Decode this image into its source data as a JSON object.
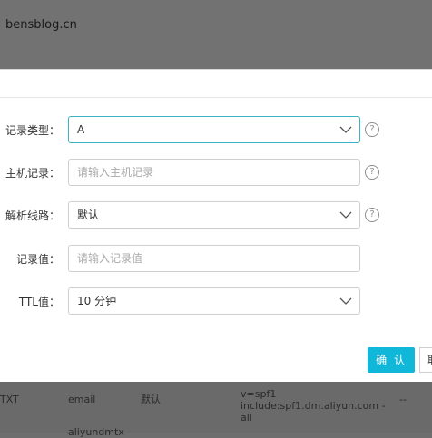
{
  "background": {
    "site_name": "bensblog.cn",
    "table_row": {
      "type": "TXT",
      "host": "email",
      "line": "默认",
      "value": "v=spf1 include:spf1.dm.aliyun.com -all",
      "ttl": "--"
    },
    "partial_row_text": "aliyundmtx"
  },
  "dialog": {
    "fields": {
      "record_type": {
        "label": "记录类型：",
        "value": "A"
      },
      "host_record": {
        "label": "主机记录：",
        "placeholder": "请输入主机记录"
      },
      "resolution_line": {
        "label": "解析线路：",
        "value": "默认"
      },
      "record_value": {
        "label": "记录值：",
        "placeholder": "请输入记录值"
      },
      "ttl": {
        "label": "TTL值：",
        "value": "10 分钟"
      }
    },
    "help_glyph": "?",
    "confirm_label": "确 认",
    "cancel_label": "取"
  },
  "colors": {
    "accent": "#10b7d9",
    "active_border": "#3bb3c4",
    "overlay": "#6e6e6e"
  }
}
